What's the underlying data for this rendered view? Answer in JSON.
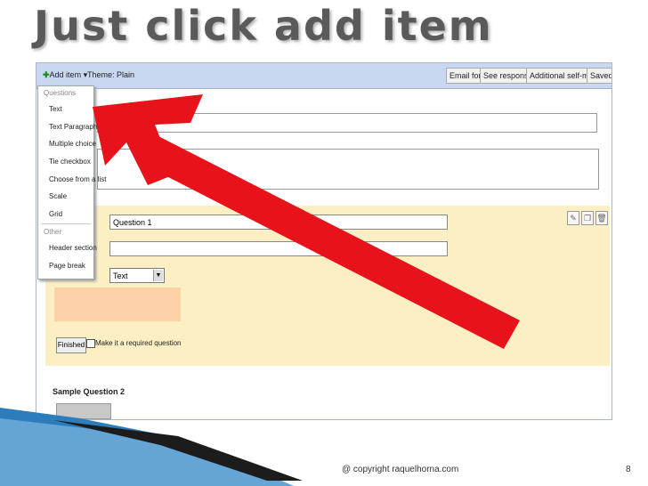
{
  "slide": {
    "title": "Just click add item",
    "footer": "@ copyright raquelhorna.com",
    "page_number": "8"
  },
  "toolbar": {
    "add_item_label": "Add item",
    "theme_label": "Theme: Plain",
    "email_form_label": "Email form",
    "see_responses_label": "See responses",
    "additional_label": "Additional self-motion",
    "saved_label": "Saved"
  },
  "add_item_menu": {
    "questions_header": "Questions",
    "question_types": [
      "Text",
      "Text Paragraph",
      "Multiple choice",
      "Tie checkbox",
      "Choose from a list",
      "Scale",
      "Grid"
    ],
    "other_header": "Other",
    "other_items": [
      "Header section",
      "Page break"
    ]
  },
  "question_editor": {
    "title_value": "Question 1",
    "type_value": "Text",
    "finished_label": "Finished",
    "required_label": "Make it a required question"
  },
  "sample": {
    "label": "Sample Question 2"
  },
  "colors": {
    "arrow": "#e8121a",
    "toolbar": "#c9d7f1",
    "edit_panel": "#fdefc4",
    "title_text": "#5a5a5a",
    "accent_blue": "#2d7dbd"
  }
}
